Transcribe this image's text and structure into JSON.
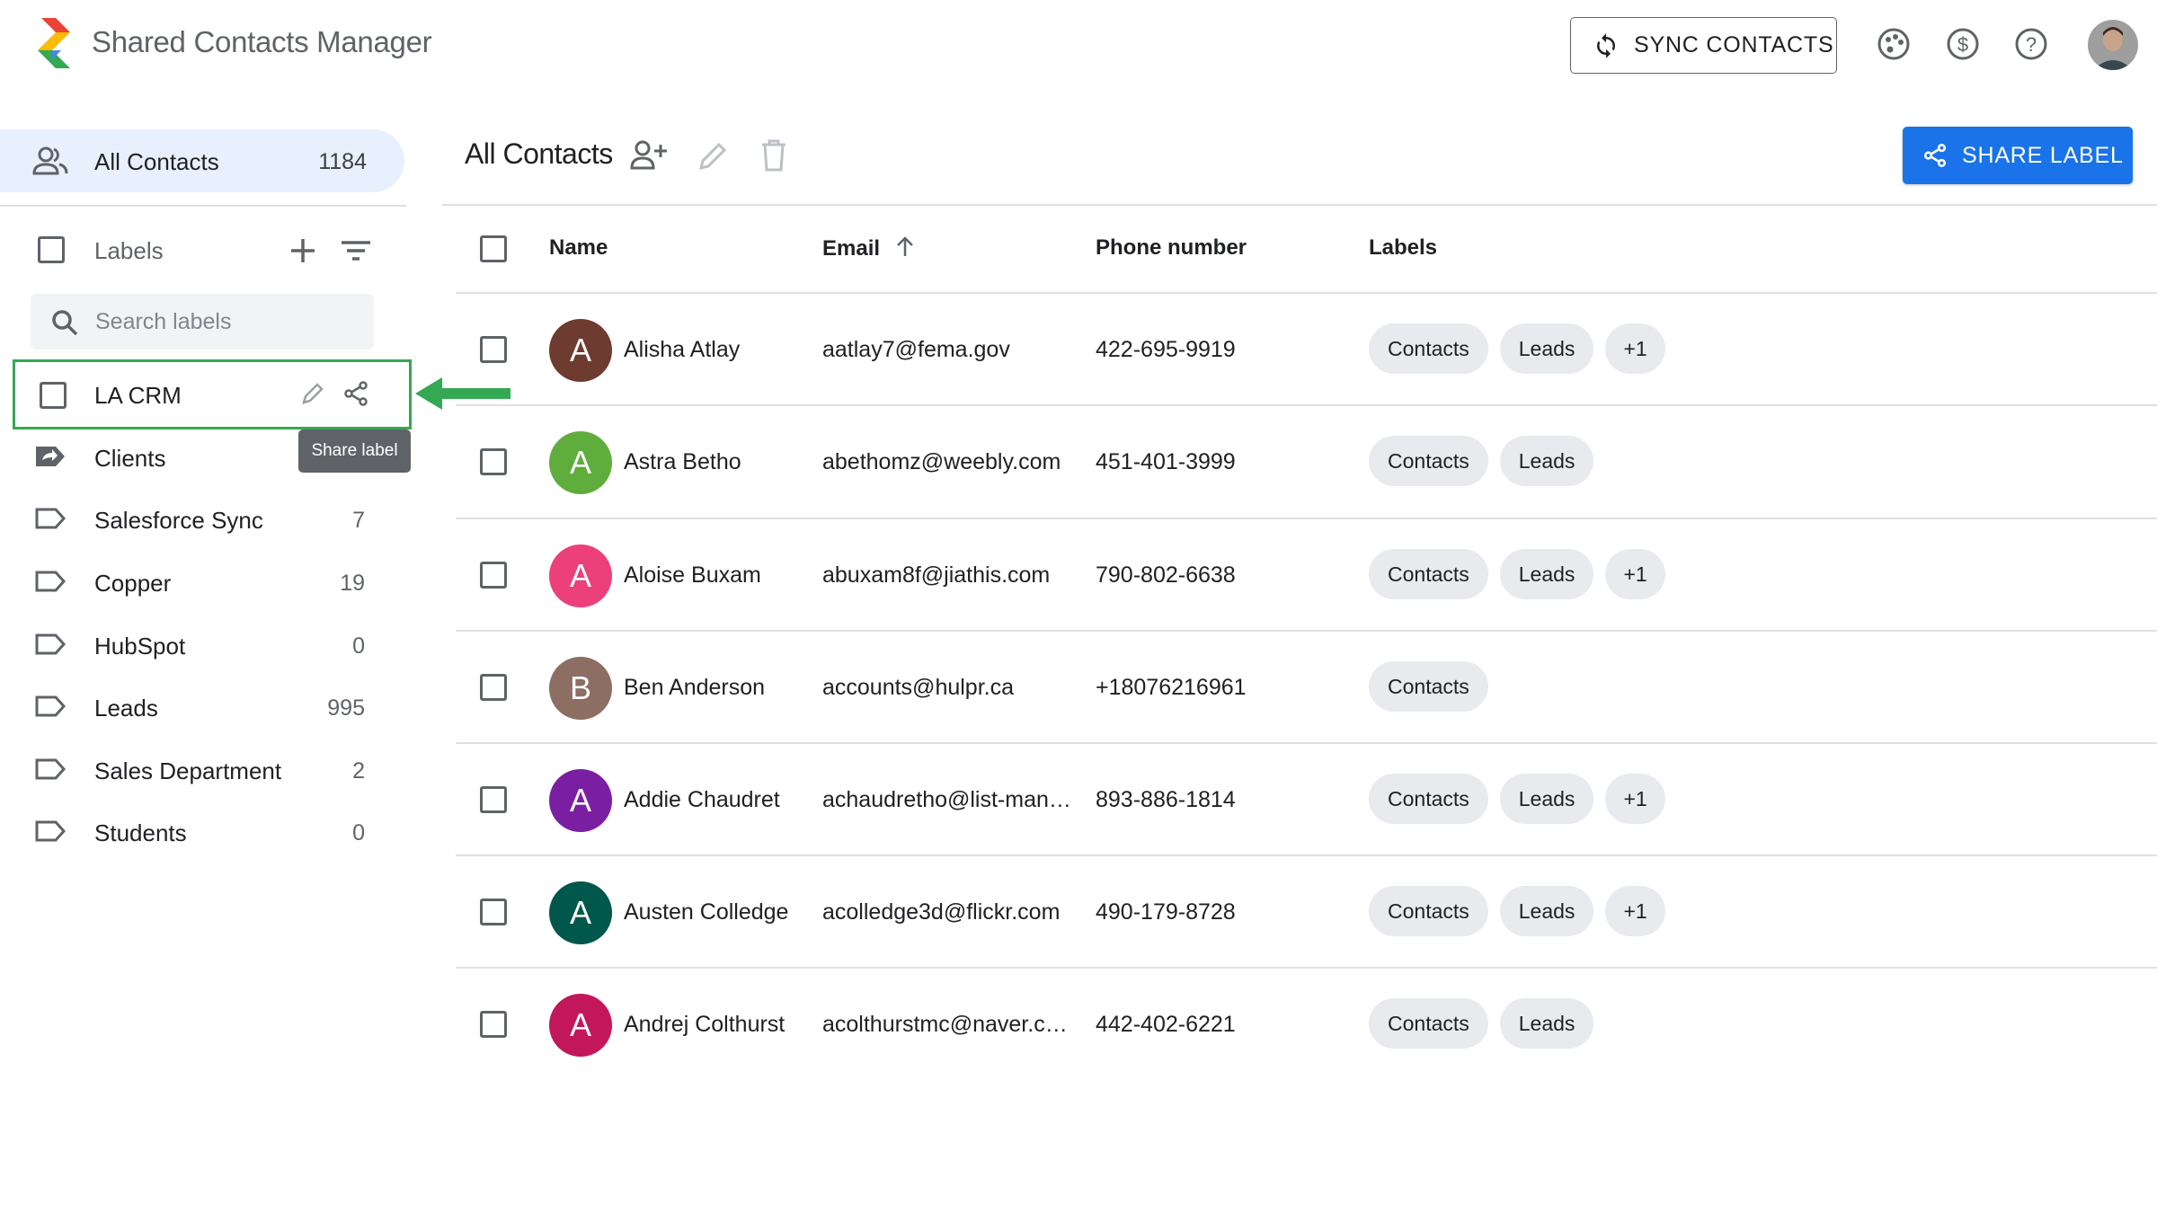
{
  "app": {
    "title": "Shared Contacts Manager",
    "sync_label": "SYNC CONTACTS"
  },
  "header_icons": [
    "palette-icon",
    "dollar-icon",
    "help-icon",
    "user-avatar"
  ],
  "sidebar": {
    "all_contacts": {
      "label": "All Contacts",
      "count": "1184"
    },
    "labels_title": "Labels",
    "search_placeholder": "Search labels",
    "items": [
      {
        "name": "LA CRM",
        "count": "",
        "icon": "checkbox"
      },
      {
        "name": "Clients",
        "count": "",
        "icon": "shared-label-icon"
      },
      {
        "name": "Salesforce Sync",
        "count": "7",
        "icon": "label-icon"
      },
      {
        "name": "Copper",
        "count": "19",
        "icon": "label-icon"
      },
      {
        "name": "HubSpot",
        "count": "0",
        "icon": "label-icon"
      },
      {
        "name": "Leads",
        "count": "995",
        "icon": "label-icon"
      },
      {
        "name": "Sales Department",
        "count": "2",
        "icon": "label-icon"
      },
      {
        "name": "Students",
        "count": "0",
        "icon": "label-icon"
      }
    ],
    "tooltip": "Share label"
  },
  "main": {
    "title": "All Contacts",
    "share_label_button": "SHARE LABEL",
    "columns": {
      "name": "Name",
      "email": "Email",
      "phone": "Phone number",
      "labels": "Labels"
    },
    "rows": [
      {
        "initial": "A",
        "color": "#6d3b2f",
        "name": "Alisha Atlay",
        "email": "aatlay7@fema.gov",
        "phone": "422-695-9919",
        "labels": [
          "Contacts",
          "Leads",
          "+1"
        ]
      },
      {
        "initial": "A",
        "color": "#5fad3c",
        "name": "Astra Betho",
        "email": "abethomz@weebly.com",
        "phone": "451-401-3999",
        "labels": [
          "Contacts",
          "Leads"
        ]
      },
      {
        "initial": "A",
        "color": "#ec407a",
        "name": "Aloise Buxam",
        "email": "abuxam8f@jiathis.com",
        "phone": "790-802-6638",
        "labels": [
          "Contacts",
          "Leads",
          "+1"
        ]
      },
      {
        "initial": "B",
        "color": "#8d6e63",
        "name": "Ben Anderson",
        "email": "accounts@hulpr.ca",
        "phone": "+18076216961",
        "labels": [
          "Contacts"
        ]
      },
      {
        "initial": "A",
        "color": "#7b1fa2",
        "name": "Addie Chaudret",
        "email": "achaudretho@list-man…",
        "phone": "893-886-1814",
        "labels": [
          "Contacts",
          "Leads",
          "+1"
        ]
      },
      {
        "initial": "A",
        "color": "#00574b",
        "name": "Austen Colledge",
        "email": "acolledge3d@flickr.com",
        "phone": "490-179-8728",
        "labels": [
          "Contacts",
          "Leads",
          "+1"
        ]
      },
      {
        "initial": "A",
        "color": "#c2185b",
        "name": "Andrej Colthurst",
        "email": "acolthurstmc@naver.c…",
        "phone": "442-402-6221",
        "labels": [
          "Contacts",
          "Leads"
        ]
      }
    ]
  },
  "colors": {
    "accent": "#1a73e8",
    "highlight": "#34a853",
    "selected_bg": "#e8f0fe"
  }
}
